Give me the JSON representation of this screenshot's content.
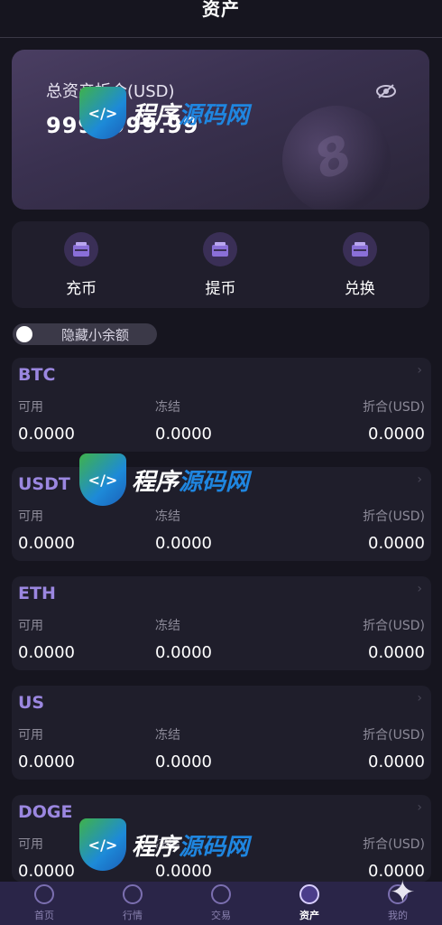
{
  "header": {
    "title": "资产"
  },
  "asset_card": {
    "label": "总资产折合(USD)",
    "value": "9999999.99",
    "eye_icon": "eye-slash-icon"
  },
  "actions": [
    {
      "label": "充币",
      "icon": "wallet-icon"
    },
    {
      "label": "提币",
      "icon": "wallet-icon"
    },
    {
      "label": "兑换",
      "icon": "wallet-icon"
    }
  ],
  "toggle": {
    "label": "隐藏小余额",
    "on": false
  },
  "coins": [
    {
      "name": "BTC",
      "available_label": "可用",
      "frozen_label": "冻结",
      "usd_label": "折合(USD)",
      "available": "0.0000",
      "frozen": "0.0000",
      "usd": "0.0000"
    },
    {
      "name": "USDT",
      "available_label": "可用",
      "frozen_label": "冻结",
      "usd_label": "折合(USD)",
      "available": "0.0000",
      "frozen": "0.0000",
      "usd": "0.0000"
    },
    {
      "name": "ETH",
      "available_label": "可用",
      "frozen_label": "冻结",
      "usd_label": "折合(USD)",
      "available": "0.0000",
      "frozen": "0.0000",
      "usd": "0.0000"
    },
    {
      "name": "US",
      "available_label": "可用",
      "frozen_label": "冻结",
      "usd_label": "折合(USD)",
      "available": "0.0000",
      "frozen": "0.0000",
      "usd": "0.0000"
    },
    {
      "name": "DOGE",
      "available_label": "可用",
      "frozen_label": "冻结",
      "usd_label": "折合(USD)",
      "available": "0.0000",
      "frozen": "0.0000",
      "usd": "0.0000"
    }
  ],
  "tabbar": [
    {
      "label": "首页",
      "icon": "home-icon",
      "active": false
    },
    {
      "label": "行情",
      "icon": "chart-icon",
      "active": false
    },
    {
      "label": "交易",
      "icon": "trade-icon",
      "active": false
    },
    {
      "label": "资产",
      "icon": "wallet-icon",
      "active": true
    },
    {
      "label": "我的",
      "icon": "user-icon",
      "active": false
    }
  ],
  "watermark": {
    "text_a": "程序",
    "text_b": "源码网",
    "shield_text": "</>"
  },
  "colors": {
    "accent": "#9b87e0",
    "tabbar": "#2a2548",
    "background": "#16151f"
  }
}
